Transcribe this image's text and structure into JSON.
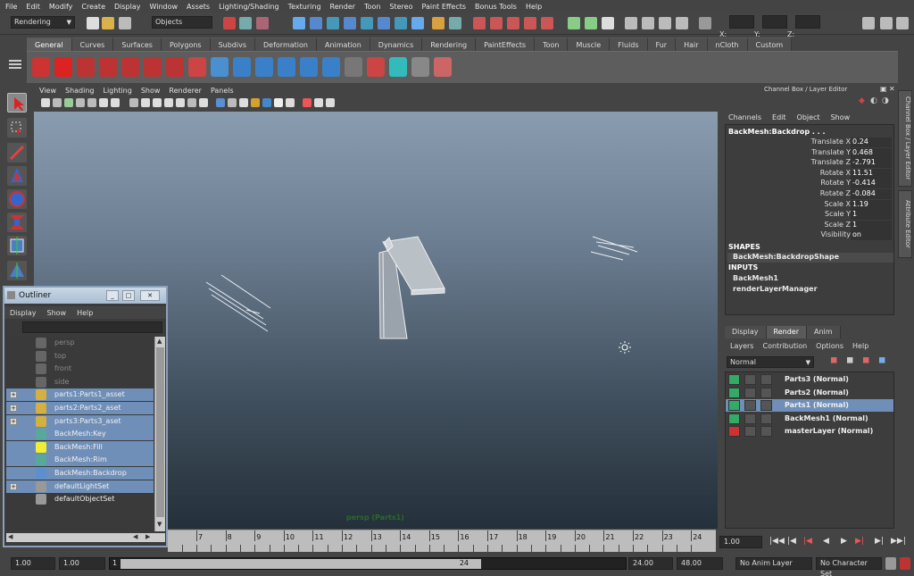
{
  "menubar": [
    "File",
    "Edit",
    "Modify",
    "Create",
    "Display",
    "Window",
    "Assets",
    "Lighting/Shading",
    "Texturing",
    "Render",
    "Toon",
    "Stereo",
    "Paint Effects",
    "Bonus Tools",
    "Help"
  ],
  "status": {
    "menuset": "Rendering",
    "selection_mode": "Objects",
    "x_label": "X:",
    "y_label": "Y:",
    "z_label": "Z:"
  },
  "shelf": {
    "tabs": [
      "General",
      "Curves",
      "Surfaces",
      "Polygons",
      "Subdivs",
      "Deformation",
      "Animation",
      "Dynamics",
      "Rendering",
      "PaintEffects",
      "Toon",
      "Muscle",
      "Fluids",
      "Fur",
      "Hair",
      "nCloth",
      "Custom"
    ],
    "active": "General"
  },
  "viewport": {
    "menus": [
      "View",
      "Shading",
      "Lighting",
      "Show",
      "Renderer",
      "Panels"
    ],
    "camera_label": "persp (Parts1)"
  },
  "channel_box": {
    "header": "Channel Box / Layer Editor",
    "menus": [
      "Channels",
      "Edit",
      "Object",
      "Show"
    ],
    "object": "BackMesh:Backdrop . . .",
    "attributes": [
      {
        "name": "Translate X",
        "value": "0.24"
      },
      {
        "name": "Translate Y",
        "value": "0.468"
      },
      {
        "name": "Translate Z",
        "value": "-2.791"
      },
      {
        "name": "Rotate X",
        "value": "11.51"
      },
      {
        "name": "Rotate Y",
        "value": "-0.414"
      },
      {
        "name": "Rotate Z",
        "value": "-0.084"
      },
      {
        "name": "Scale X",
        "value": "1.19"
      },
      {
        "name": "Scale Y",
        "value": "1"
      },
      {
        "name": "Scale Z",
        "value": "1"
      },
      {
        "name": "Visibility",
        "value": "on"
      }
    ],
    "shapes_label": "SHAPES",
    "shapes": [
      "BackMesh:BackdropShape"
    ],
    "inputs_label": "INPUTS",
    "inputs": [
      "BackMesh1",
      "renderLayerManager"
    ]
  },
  "side_tabs": [
    "Channel Box / Layer Editor",
    "Attribute Editor"
  ],
  "layer_editor": {
    "tabs": [
      "Display",
      "Render",
      "Anim"
    ],
    "active": "Render",
    "menus": [
      "Layers",
      "Contribution",
      "Options",
      "Help"
    ],
    "mode": "Normal",
    "layers": [
      {
        "name": "Parts3 (Normal)",
        "selected": false
      },
      {
        "name": "Parts2 (Normal)",
        "selected": false
      },
      {
        "name": "Parts1 (Normal)",
        "selected": true
      },
      {
        "name": "BackMesh1 (Normal)",
        "selected": false
      },
      {
        "name": "masterLayer (Normal)",
        "selected": false
      }
    ]
  },
  "outliner": {
    "title": "Outliner",
    "menus": [
      "Display",
      "Show",
      "Help"
    ],
    "items": [
      {
        "label": "persp",
        "selected": false,
        "gray": true,
        "expand": false
      },
      {
        "label": "top",
        "selected": false,
        "gray": true,
        "expand": false
      },
      {
        "label": "front",
        "selected": false,
        "gray": true,
        "expand": false
      },
      {
        "label": "side",
        "selected": false,
        "gray": true,
        "expand": false
      },
      {
        "label": "parts1:Parts1_asset",
        "selected": true,
        "gray": false,
        "expand": true
      },
      {
        "label": "parts2:Parts2_aset",
        "selected": true,
        "gray": false,
        "expand": true
      },
      {
        "label": "parts3:Parts3_aset",
        "selected": true,
        "gray": false,
        "expand": true
      },
      {
        "label": "BackMesh:Key",
        "selected": true,
        "gray": false,
        "expand": false
      },
      {
        "label": "BackMesh:Fill",
        "selected": true,
        "gray": false,
        "expand": false
      },
      {
        "label": "BackMesh:Rim",
        "selected": true,
        "gray": false,
        "expand": false
      },
      {
        "label": "BackMesh:Backdrop",
        "selected": true,
        "gray": false,
        "expand": false
      },
      {
        "label": "defaultLightSet",
        "selected": true,
        "gray": false,
        "expand": true
      },
      {
        "label": "defaultObjectSet",
        "selected": false,
        "gray": false,
        "expand": false
      }
    ]
  },
  "timeline": {
    "ticks": [
      "7",
      "8",
      "9",
      "10",
      "11",
      "12",
      "13",
      "14",
      "15",
      "16",
      "17",
      "18",
      "19",
      "20",
      "21",
      "22",
      "23",
      "24"
    ],
    "current_frame": "1.00"
  },
  "range": {
    "start_field": "1.00",
    "playback_start": "1.00",
    "slider_start": "1",
    "slider_end": "24",
    "playback_end": "24.00",
    "end_field": "48.00",
    "anim_layer": "No Anim Layer",
    "character_set": "No Character Set"
  }
}
